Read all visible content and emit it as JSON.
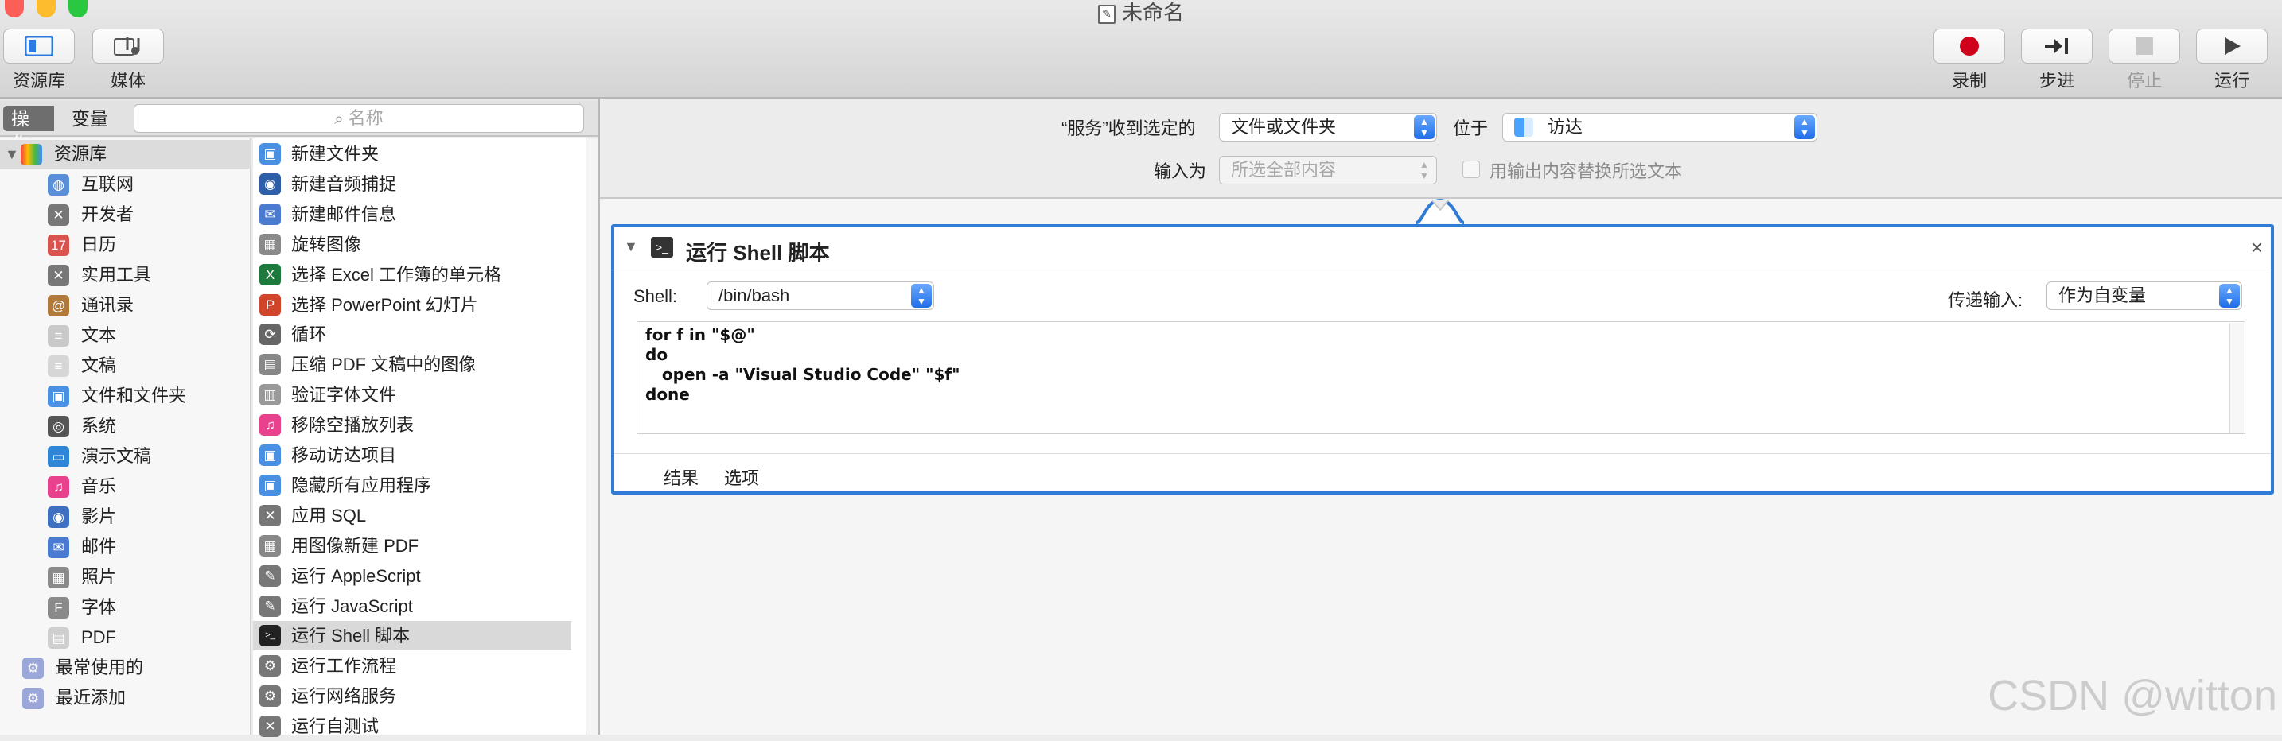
{
  "window": {
    "title": "未命名"
  },
  "toolbar": {
    "library_label": "资源库",
    "media_label": "媒体",
    "record_label": "录制",
    "step_label": "步进",
    "stop_label": "停止",
    "run_label": "运行"
  },
  "left_tabs": {
    "actions": "操作",
    "variables": "变量",
    "search_placeholder": "名称"
  },
  "library": {
    "root": "资源库",
    "items": [
      "互联网",
      "开发者",
      "日历",
      "实用工具",
      "通讯录",
      "文本",
      "文稿",
      "文件和文件夹",
      "系统",
      "演示文稿",
      "音乐",
      "影片",
      "邮件",
      "照片",
      "字体",
      "PDF"
    ],
    "extra": [
      "最常使用的",
      "最近添加"
    ]
  },
  "actions": [
    "新建文件夹",
    "新建音频捕捉",
    "新建邮件信息",
    "旋转图像",
    "选择 Excel 工作簿的单元格",
    "选择 PowerPoint 幻灯片",
    "循环",
    "压缩 PDF 文稿中的图像",
    "验证字体文件",
    "移除空播放列表",
    "移动访达项目",
    "隐藏所有应用程序",
    "应用 SQL",
    "用图像新建 PDF",
    "运行 AppleScript",
    "运行 JavaScript",
    "运行 Shell 脚本",
    "运行工作流程",
    "运行网络服务",
    "运行自测试"
  ],
  "workflow": {
    "receives_label": "“服务”收到选定的",
    "receives_value": "文件或文件夹",
    "in_label": "位于",
    "in_value": "访达",
    "input_label": "输入为",
    "input_value": "所选全部内容",
    "replace_label": "用输出内容替换所选文本"
  },
  "action_card": {
    "title": "运行 Shell 脚本",
    "shell_label": "Shell:",
    "shell_value": "/bin/bash",
    "pass_label": "传递输入:",
    "pass_value": "作为自变量",
    "script": "for f in \"$@\"\ndo\n   open -a \"Visual Studio Code\" \"$f\"\ndone",
    "tab_results": "结果",
    "tab_options": "选项"
  },
  "watermark": "CSDN @witton",
  "colors": {
    "accent": "#2f7bd6",
    "record": "#d0021b",
    "popup_arrow": "#1f6de8"
  }
}
